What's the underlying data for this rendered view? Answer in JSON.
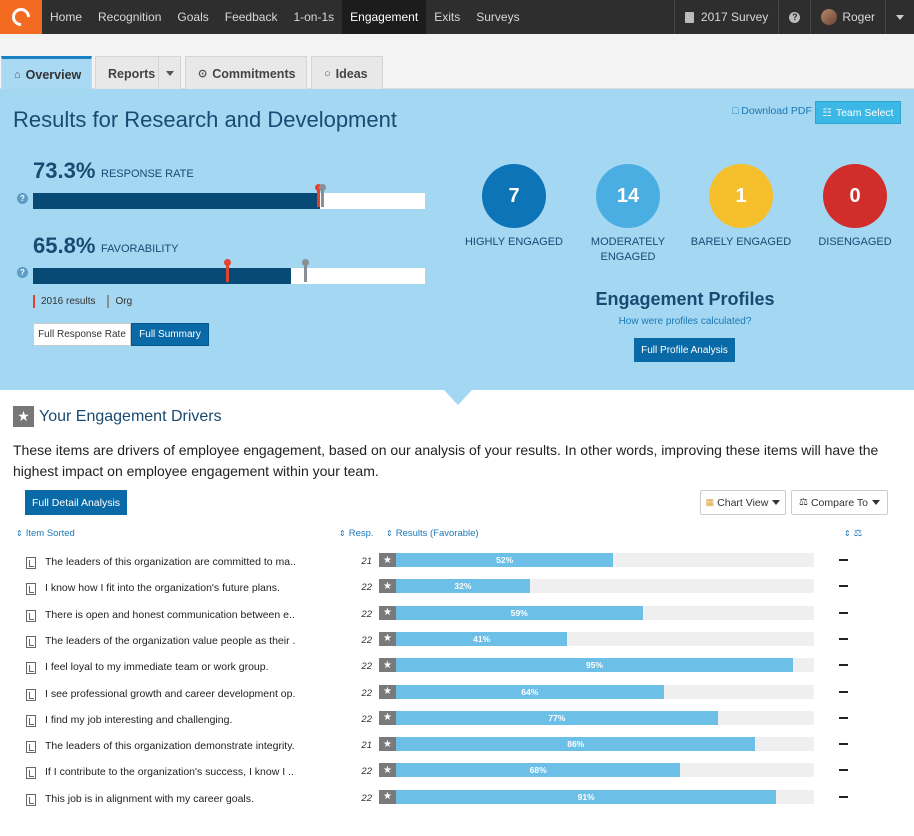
{
  "nav": {
    "links": [
      "Home",
      "Recognition",
      "Goals",
      "Feedback",
      "1-on-1s",
      "Engagement",
      "Exits",
      "Surveys"
    ],
    "active": "Engagement",
    "survey_label": "2017 Survey",
    "help": "?",
    "user": "Roger"
  },
  "tabs": {
    "overview": "Overview",
    "reports": "Reports",
    "commitments": "Commitments",
    "ideas": "Ideas"
  },
  "hero": {
    "title": "Results for Research and Development",
    "download_pdf": "Download PDF",
    "team_select": "Team Select",
    "response_rate": {
      "value": "73.3%",
      "label": "RESPONSE RATE",
      "fill": 0.733,
      "marker_2016": 0.727,
      "marker_org": 0.737
    },
    "favorability": {
      "value": "65.8%",
      "label": "FAVORABILITY",
      "fill": 0.658,
      "marker_2016": 0.496,
      "marker_org": 0.693
    },
    "legend_2016": "2016 results",
    "legend_org": "Org",
    "full_response_rate": "Full Response Rate",
    "full_summary": "Full Summary",
    "colors": {
      "marker_2016": "#e0432f",
      "marker_org": "#8a8f95",
      "bar": "#064a75"
    }
  },
  "engagement": {
    "circles": [
      {
        "value": "7",
        "label": "HIGHLY ENGAGED",
        "color": "#0d74b8"
      },
      {
        "value": "14",
        "label": "MODERATELY ENGAGED",
        "color": "#4aaee3"
      },
      {
        "value": "1",
        "label": "BARELY ENGAGED",
        "color": "#f6bf2c"
      },
      {
        "value": "0",
        "label": "DISENGAGED",
        "color": "#d02d2b"
      }
    ],
    "profiles_title": "Engagement Profiles",
    "profiles_link": "How were profiles calculated?",
    "profiles_button": "Full Profile Analysis"
  },
  "drivers": {
    "title": "Your Engagement Drivers",
    "description": "These items are drivers of employee engagement, based on our analysis of your results. In other words, improving these items will have the highest impact on employee engagement within your team.",
    "full_detail_button": "Full Detail Analysis",
    "chart_view": "Chart View",
    "compare_to": "Compare To",
    "headers": {
      "item": "Item Sorted",
      "resp": "Resp.",
      "results": "Results (Favorable)"
    },
    "rows": [
      {
        "text": "The leaders of this organization are committed to ma...",
        "resp": "21",
        "pct": "52%",
        "value": 52
      },
      {
        "text": "I know how I fit into the organization's future plans.",
        "resp": "22",
        "pct": "32%",
        "value": 32
      },
      {
        "text": "There is open and honest communication between e...",
        "resp": "22",
        "pct": "59%",
        "value": 59
      },
      {
        "text": "The leaders of the organization value people as their ...",
        "resp": "22",
        "pct": "41%",
        "value": 41
      },
      {
        "text": "I feel loyal to my immediate team or work group.",
        "resp": "22",
        "pct": "95%",
        "value": 95
      },
      {
        "text": "I see professional growth and career development op...",
        "resp": "22",
        "pct": "64%",
        "value": 64
      },
      {
        "text": "I find my job interesting and challenging.",
        "resp": "22",
        "pct": "77%",
        "value": 77
      },
      {
        "text": "The leaders of this organization demonstrate integrity.",
        "resp": "21",
        "pct": "86%",
        "value": 86
      },
      {
        "text": "If I contribute to the organization's success, I know I ...",
        "resp": "22",
        "pct": "68%",
        "value": 68
      },
      {
        "text": "This job is in alignment with my career goals.",
        "resp": "22",
        "pct": "91%",
        "value": 91
      }
    ]
  }
}
